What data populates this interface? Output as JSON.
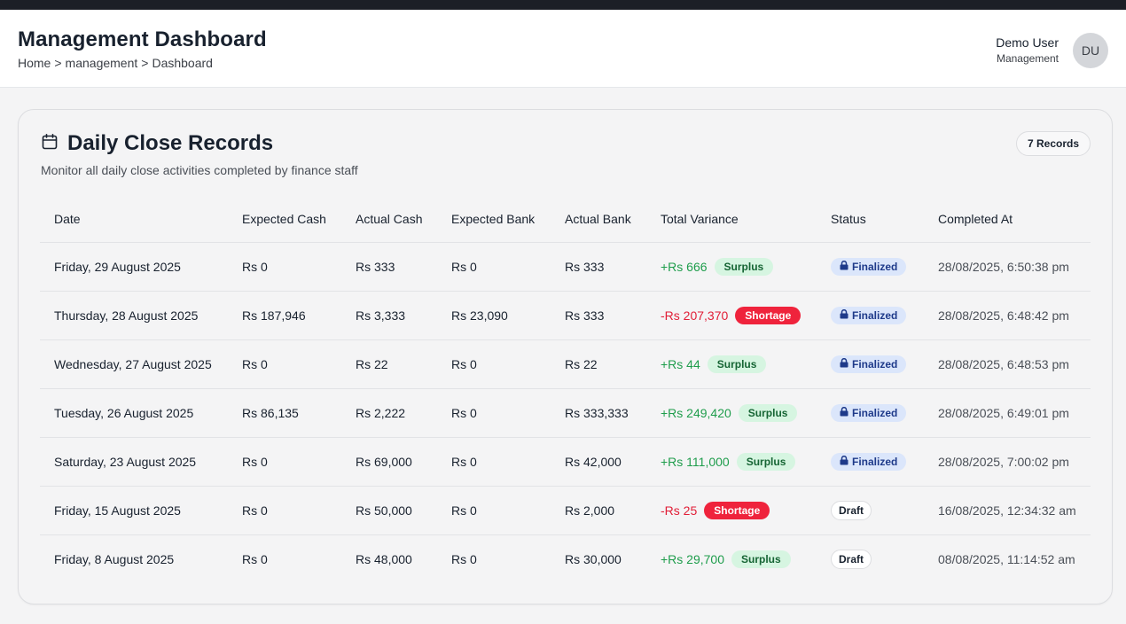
{
  "header": {
    "title": "Management Dashboard",
    "breadcrumb": [
      "Home",
      ">",
      "management",
      ">",
      "Dashboard"
    ],
    "user_name": "Demo User",
    "user_role": "Management",
    "avatar_initials": "DU"
  },
  "card": {
    "title": "Daily Close Records",
    "subtitle": "Monitor all daily close activities completed by finance staff",
    "record_count": "7 Records",
    "icon": "calendar-icon"
  },
  "table": {
    "columns": [
      "Date",
      "Expected Cash",
      "Actual Cash",
      "Expected Bank",
      "Actual Bank",
      "Total Variance",
      "Status",
      "Completed At"
    ],
    "rows": [
      {
        "date": "Friday, 29 August 2025",
        "expected_cash": "Rs 0",
        "actual_cash": "Rs 333",
        "expected_bank": "Rs 0",
        "actual_bank": "Rs 333",
        "variance": "+Rs 666",
        "variance_type": "Surplus",
        "status": "Finalized",
        "completed_at": "28/08/2025, 6:50:38 pm"
      },
      {
        "date": "Thursday, 28 August 2025",
        "expected_cash": "Rs 187,946",
        "actual_cash": "Rs 3,333",
        "expected_bank": "Rs 23,090",
        "actual_bank": "Rs 333",
        "variance": "-Rs 207,370",
        "variance_type": "Shortage",
        "status": "Finalized",
        "completed_at": "28/08/2025, 6:48:42 pm"
      },
      {
        "date": "Wednesday, 27 August 2025",
        "expected_cash": "Rs 0",
        "actual_cash": "Rs 22",
        "expected_bank": "Rs 0",
        "actual_bank": "Rs 22",
        "variance": "+Rs 44",
        "variance_type": "Surplus",
        "status": "Finalized",
        "completed_at": "28/08/2025, 6:48:53 pm"
      },
      {
        "date": "Tuesday, 26 August 2025",
        "expected_cash": "Rs 86,135",
        "actual_cash": "Rs 2,222",
        "expected_bank": "Rs 0",
        "actual_bank": "Rs 333,333",
        "variance": "+Rs 249,420",
        "variance_type": "Surplus",
        "status": "Finalized",
        "completed_at": "28/08/2025, 6:49:01 pm"
      },
      {
        "date": "Saturday, 23 August 2025",
        "expected_cash": "Rs 0",
        "actual_cash": "Rs 69,000",
        "expected_bank": "Rs 0",
        "actual_bank": "Rs 42,000",
        "variance": "+Rs 111,000",
        "variance_type": "Surplus",
        "status": "Finalized",
        "completed_at": "28/08/2025, 7:00:02 pm"
      },
      {
        "date": "Friday, 15 August 2025",
        "expected_cash": "Rs 0",
        "actual_cash": "Rs 50,000",
        "expected_bank": "Rs 0",
        "actual_bank": "Rs 2,000",
        "variance": "-Rs 25",
        "variance_type": "Shortage",
        "status": "Draft",
        "completed_at": "16/08/2025, 12:34:32 am"
      },
      {
        "date": "Friday, 8 August 2025",
        "expected_cash": "Rs 0",
        "actual_cash": "Rs 48,000",
        "expected_bank": "Rs 0",
        "actual_bank": "Rs 30,000",
        "variance": "+Rs 29,700",
        "variance_type": "Surplus",
        "status": "Draft",
        "completed_at": "08/08/2025, 11:14:52 am"
      }
    ]
  },
  "colors": {
    "surplus_text": "#1f9d4c",
    "shortage_text": "#e11d36",
    "shortage_pill": "#ef233c",
    "surplus_pill": "#d6f5e1",
    "finalized_pill": "#dbe6fb"
  }
}
